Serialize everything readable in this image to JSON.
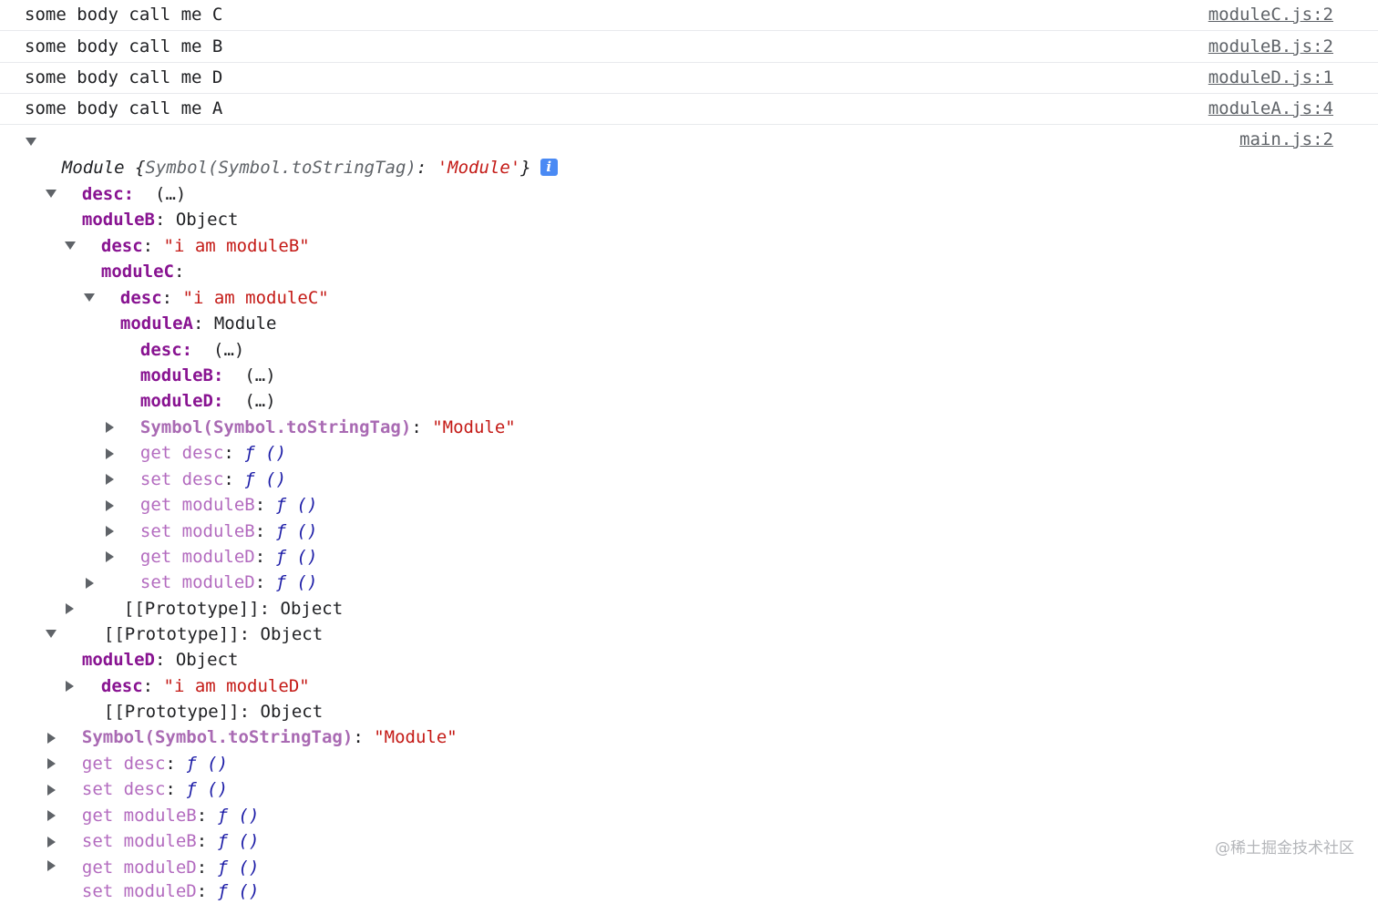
{
  "messages": [
    {
      "text": "some body call me C",
      "source": "moduleC.js:2"
    },
    {
      "text": "some body call me B",
      "source": "moduleB.js:2"
    },
    {
      "text": "some body call me D",
      "source": "moduleD.js:1"
    },
    {
      "text": "some body call me A",
      "source": "moduleA.js:4"
    }
  ],
  "object_log": {
    "source": "main.js:2",
    "header_name": "Module",
    "header_open": " {",
    "header_key": "Symbol(Symbol.toStringTag)",
    "header_colon": ": ",
    "header_val": "'Module'",
    "header_close": "}",
    "info_icon": "i"
  },
  "tree": [
    {
      "key": "desc",
      "val": "(…)"
    },
    {
      "key": "moduleB",
      "val": "Object"
    },
    {
      "key": "desc",
      "val": "\"i am moduleB\""
    },
    {
      "key": "moduleC",
      "val": ""
    },
    {
      "key": "desc",
      "val": "\"i am moduleC\""
    },
    {
      "key": "moduleA",
      "val": "Module"
    },
    {
      "key": "desc",
      "val": "(…)"
    },
    {
      "key": "moduleB",
      "val": "(…)"
    },
    {
      "key": "moduleD",
      "val": "(…)"
    },
    {
      "key": "Symbol(Symbol.toStringTag)",
      "val": "\"Module\""
    },
    {
      "key": "get desc",
      "val": "ƒ ()"
    },
    {
      "key": "set desc",
      "val": "ƒ ()"
    },
    {
      "key": "get moduleB",
      "val": "ƒ ()"
    },
    {
      "key": "set moduleB",
      "val": "ƒ ()"
    },
    {
      "key": "get moduleD",
      "val": "ƒ ()"
    },
    {
      "key": "set moduleD",
      "val": "ƒ ()"
    },
    {
      "key": "[[Prototype]]",
      "val": "Object"
    },
    {
      "key": "[[Prototype]]",
      "val": "Object"
    },
    {
      "key": "moduleD",
      "val": "Object"
    },
    {
      "key": "desc",
      "val": "\"i am moduleD\""
    },
    {
      "key": "[[Prototype]]",
      "val": "Object"
    },
    {
      "key": "Symbol(Symbol.toStringTag)",
      "val": "\"Module\""
    },
    {
      "key": "get desc",
      "val": "ƒ ()"
    },
    {
      "key": "set desc",
      "val": "ƒ ()"
    },
    {
      "key": "get moduleB",
      "val": "ƒ ()"
    },
    {
      "key": "set moduleB",
      "val": "ƒ ()"
    },
    {
      "key": "get moduleD",
      "val": "ƒ ()"
    },
    {
      "key": "set moduleD",
      "val": "ƒ ()"
    }
  ],
  "punct": {
    "colon": ": "
  },
  "watermark": "@稀土掘金技术社区",
  "colors": {
    "key": "#881391",
    "accessor": "#b36bbf",
    "string": "#c41a16",
    "function": "#1a1aa6",
    "info_badge": "#4a8af4"
  }
}
